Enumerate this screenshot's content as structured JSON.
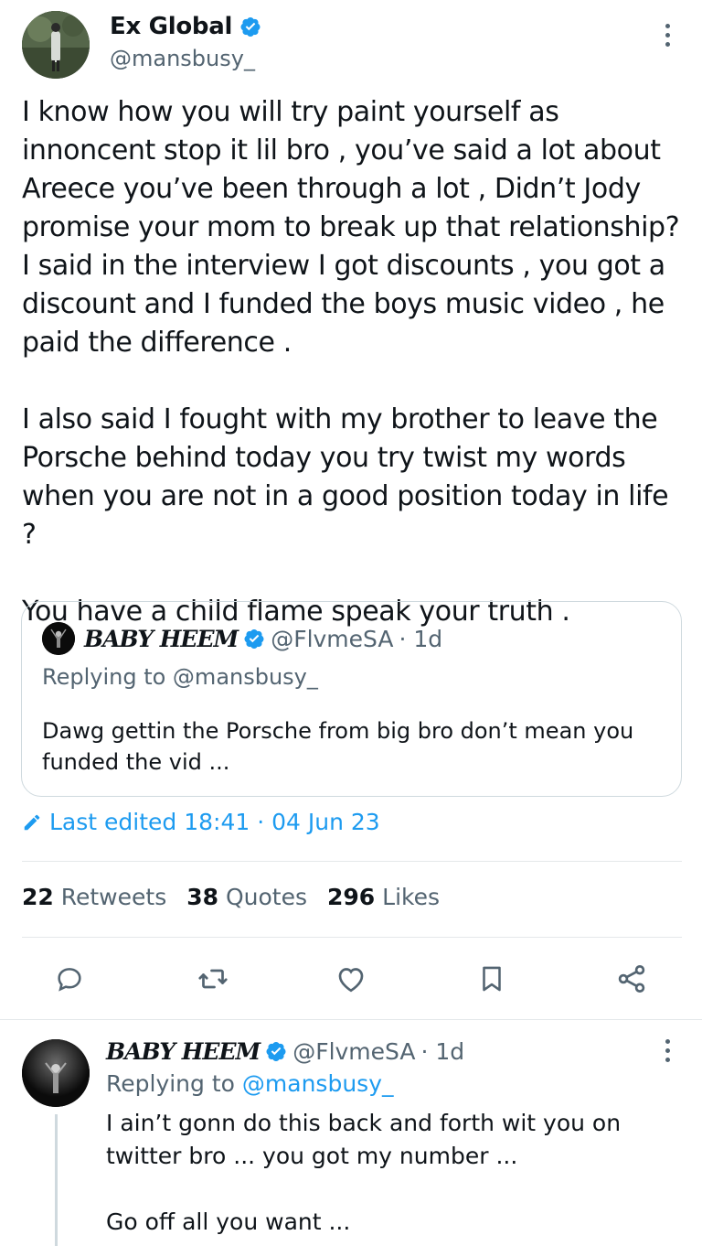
{
  "tweet": {
    "author_name": "Ex Global",
    "author_handle": "@mansbusy_",
    "paragraphs": [
      "I know how you will try paint yourself as innoncent stop it lil bro , you’ve said a lot about Areece you’ve been through a lot , Didn’t Jody promise your mom to break up that relationship? I said in the interview I got discounts , you got a discount and I funded the boys music video , he paid the difference .",
      "I also said I fought with my brother to leave the Porsche behind today you try twist my words when you are not in a good position today in life ?",
      "You have a child flame speak your truth ."
    ],
    "quote": {
      "author_name": "BABY HEEM",
      "author_handle": "@FlvmeSA",
      "time": "· 1d",
      "replying_to": "Replying to @mansbusy_",
      "text": "Dawg gettin the Porsche from big bro don’t mean you funded the vid ..."
    },
    "edited_label": "Last edited 18:41 · 04 Jun 23",
    "stats": {
      "retweets_count": "22",
      "retweets_label": "Retweets",
      "quotes_count": "38",
      "quotes_label": "Quotes",
      "likes_count": "296",
      "likes_label": "Likes"
    },
    "actions": [
      "reply-icon",
      "retweet-icon",
      "like-icon",
      "bookmark-icon",
      "share-icon"
    ]
  },
  "reply": {
    "author_name": "BABY HEEM",
    "author_handle": "@FlvmeSA",
    "time": "· 1d",
    "replying_prefix": "Replying to",
    "replying_handle": "@mansbusy_",
    "paragraphs": [
      "I ain’t gonn do this back and forth wit you on twitter bro ... you got my number ...",
      "Go off all you want ..."
    ]
  },
  "colors": {
    "accent": "#1d9bf0",
    "secondary_text": "#536471",
    "border": "#cfd9de"
  }
}
